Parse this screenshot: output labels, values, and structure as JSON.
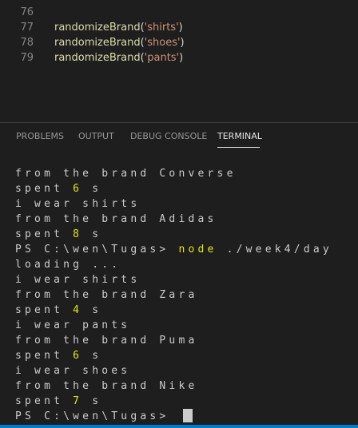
{
  "editor": {
    "lines": [
      {
        "num": "76",
        "fn": "",
        "arg": ""
      },
      {
        "num": "77",
        "fn": "randomizeBrand",
        "arg": "'shirts'"
      },
      {
        "num": "78",
        "fn": "randomizeBrand",
        "arg": "'shoes'"
      },
      {
        "num": "79",
        "fn": "randomizeBrand",
        "arg": "'pants'"
      }
    ]
  },
  "panel": {
    "tabs": [
      "PROBLEMS",
      "OUTPUT",
      "DEBUG CONSOLE",
      "TERMINAL"
    ],
    "active_tab": "TERMINAL"
  },
  "terminal": {
    "lines": [
      {
        "text": "from the brand Converse"
      },
      {
        "pre": "spent ",
        "num": "6",
        "post": " s"
      },
      {
        "text": "i wear shirts"
      },
      {
        "text": "from the brand Adidas"
      },
      {
        "pre": "spent ",
        "num": "8",
        "post": " s"
      },
      {
        "prompt": "PS C:\\wen\\Tugas> ",
        "cmd": "node",
        "args": " ./week4/day"
      },
      {
        "text": "loading ..."
      },
      {
        "text": "i wear shirts"
      },
      {
        "text": "from the brand Zara"
      },
      {
        "pre": "spent ",
        "num": "4",
        "post": " s"
      },
      {
        "text": "i wear pants"
      },
      {
        "text": "from the brand Puma"
      },
      {
        "pre": "spent ",
        "num": "6",
        "post": " s"
      },
      {
        "text": "i wear shoes"
      },
      {
        "text": "from the brand Nike"
      },
      {
        "pre": "spent ",
        "num": "7",
        "post": " s"
      },
      {
        "prompt": "PS C:\\wen\\Tugas> ",
        "cursor": true
      }
    ]
  },
  "colors": {
    "background": "#1e1e1e",
    "function": "#dcdcaa",
    "string": "#ce9178",
    "yellow": "#e5e510",
    "statusbar": "#007acc"
  }
}
